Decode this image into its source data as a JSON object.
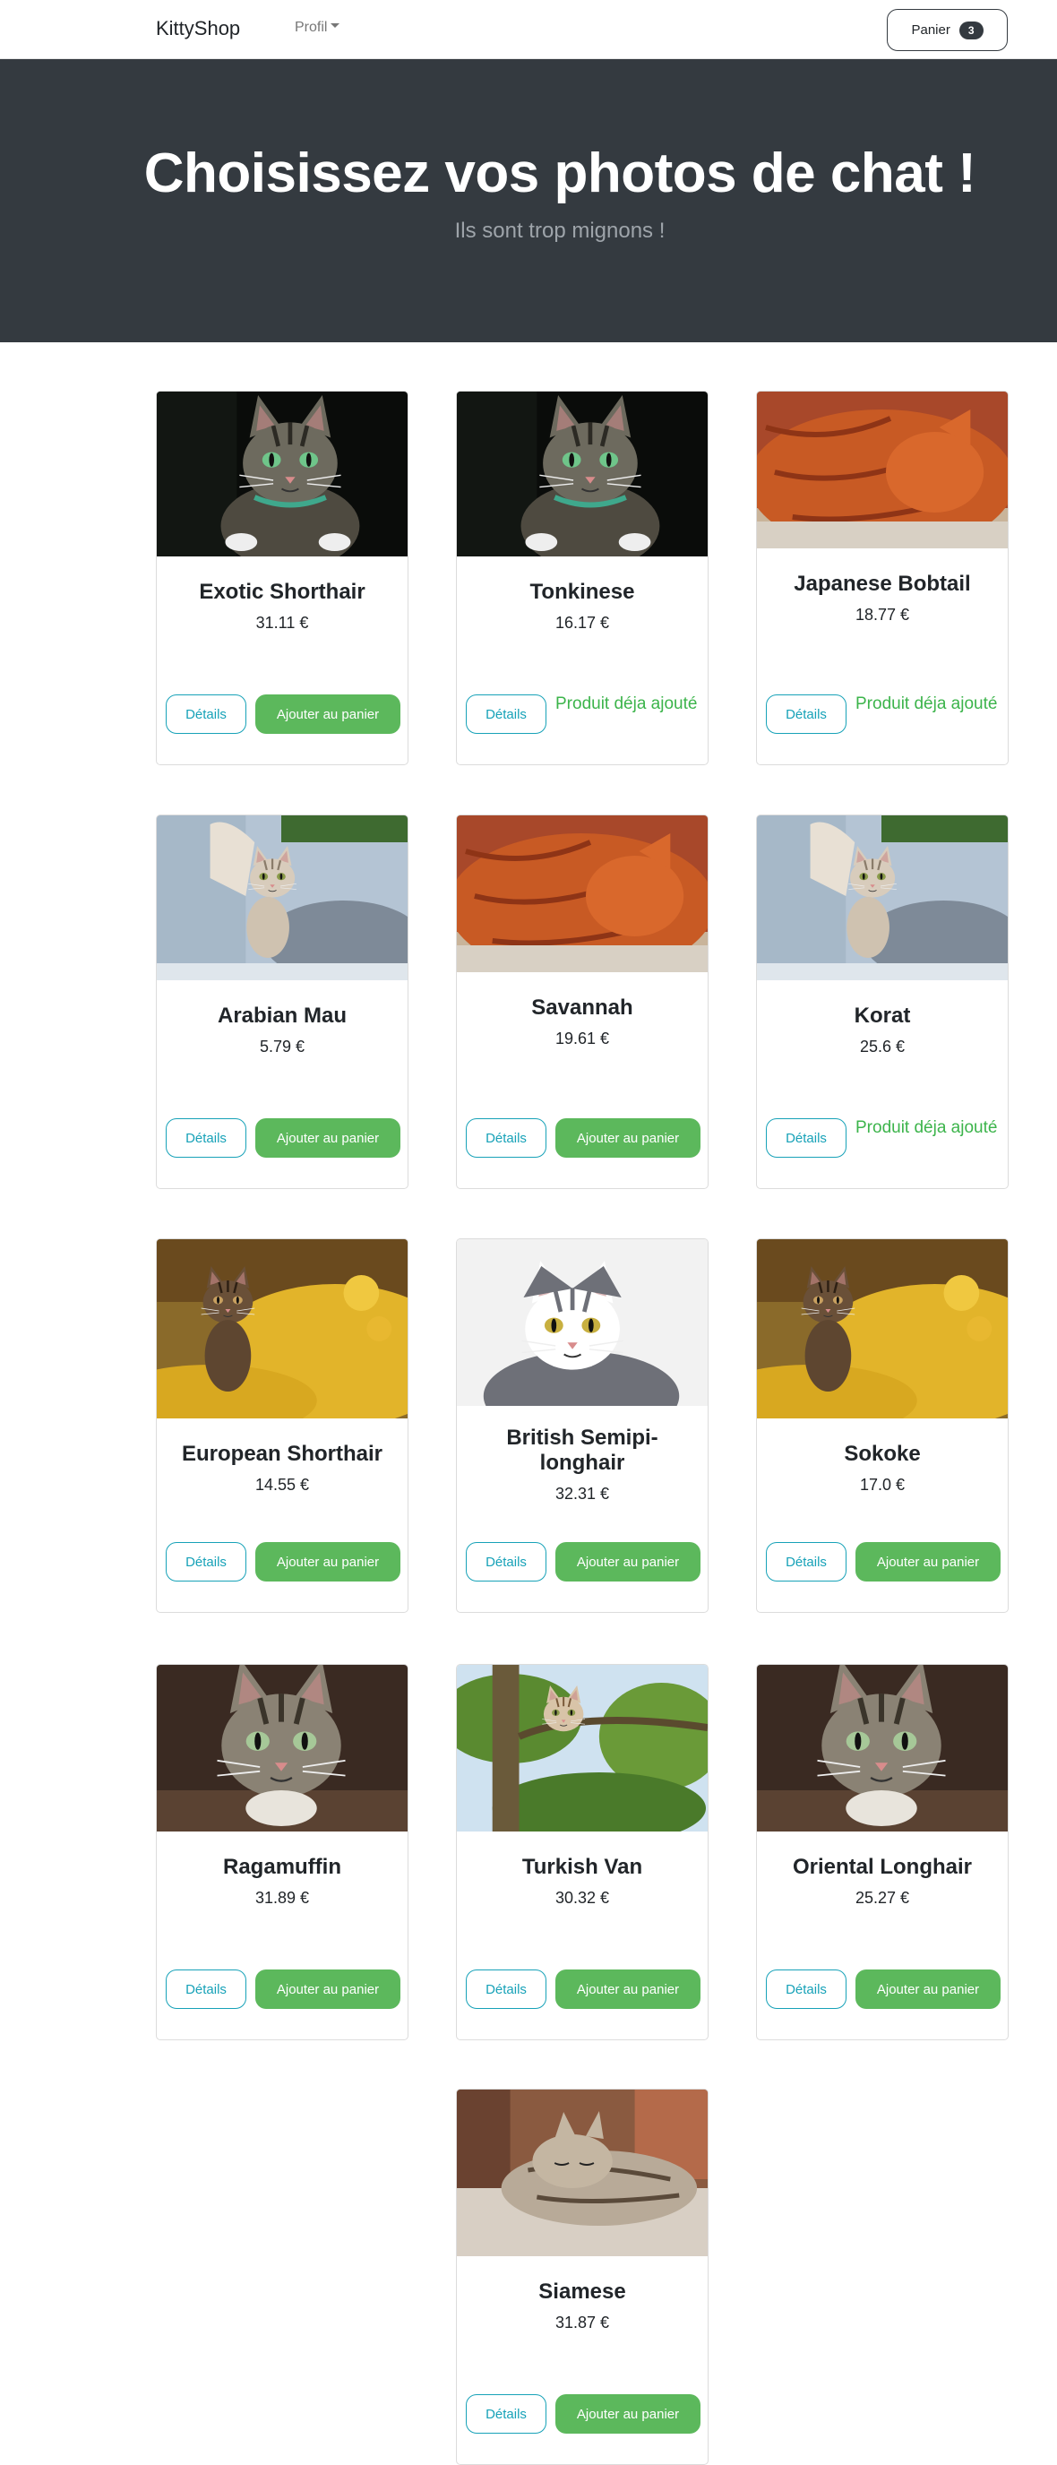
{
  "navbar": {
    "brand": "KittyShop",
    "profile_label": "Profil",
    "cart_label": "Panier",
    "cart_count": "3"
  },
  "hero": {
    "title": "Choisissez vos photos de chat !",
    "subtitle": "Ils sont trop mignons !"
  },
  "buttons": {
    "details": "Détails",
    "add": "Ajouter au panier",
    "added": "Produit déja ajouté"
  },
  "products": [
    {
      "name": "Exotic Shorthair",
      "price": "31.11 €",
      "in_cart": false,
      "image": "tabby-cat-dark-background"
    },
    {
      "name": "Tonkinese",
      "price": "16.17 €",
      "in_cart": true,
      "image": "tabby-cat-dark-background"
    },
    {
      "name": "Japanese Bobtail",
      "price": "18.77 €",
      "in_cart": true,
      "image": "orange-cat-sleeping"
    },
    {
      "name": "Arabian Mau",
      "price": "5.79 €",
      "in_cart": false,
      "image": "kitten-on-couch"
    },
    {
      "name": "Savannah",
      "price": "19.61 €",
      "in_cart": false,
      "image": "orange-cat-sleeping"
    },
    {
      "name": "Korat",
      "price": "25.6 €",
      "in_cart": true,
      "image": "kitten-on-couch"
    },
    {
      "name": "European Shorthair",
      "price": "14.55 €",
      "in_cart": false,
      "image": "kitten-yellow-flowers"
    },
    {
      "name": "British Semipi-longhair",
      "price": "32.31 €",
      "in_cart": false,
      "image": "grey-white-cat-portrait"
    },
    {
      "name": "Sokoke",
      "price": "17.0 €",
      "in_cart": false,
      "image": "kitten-yellow-flowers"
    },
    {
      "name": "Ragamuffin",
      "price": "31.89 €",
      "in_cart": false,
      "image": "tabby-cat-closeup"
    },
    {
      "name": "Turkish Van",
      "price": "30.32 €",
      "in_cart": false,
      "image": "cat-in-tree"
    },
    {
      "name": "Oriental Longhair",
      "price": "25.27 €",
      "in_cart": false,
      "image": "tabby-cat-closeup"
    },
    {
      "name": "Siamese",
      "price": "31.87 €",
      "in_cart": false,
      "image": "kitten-sleeping-on-table"
    }
  ]
}
